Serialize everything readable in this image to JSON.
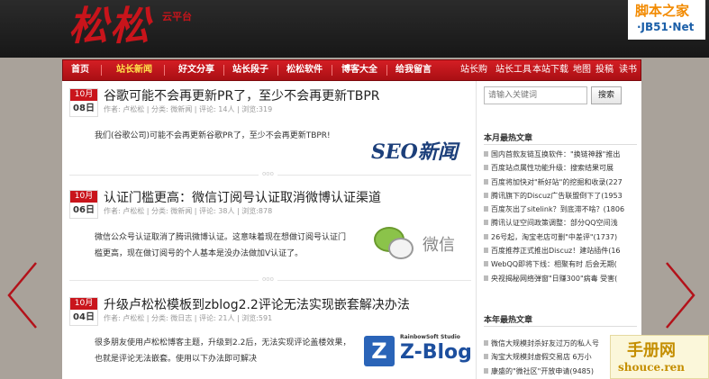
{
  "header": {
    "logo": "松松",
    "logo_sub": "云平台",
    "corner_logo_line1": "脚本之家",
    "corner_logo_line2": "·JB51·Net"
  },
  "nav": {
    "left": [
      "首页",
      "站长新闻",
      "好文分享",
      "站长段子",
      "松松软件",
      "博客大全",
      "给我留言"
    ],
    "active_index": 1,
    "right": [
      "站长购",
      "站长工具",
      "本站下载",
      "地图",
      "投稿",
      "读书"
    ]
  },
  "posts": [
    {
      "month": "10月",
      "day": "08日",
      "title": "谷歌可能不会再更新PR了，至少不会再更新TBPR",
      "meta": "作者: 卢松松 | 分类: 微新闻 | 评论: 14人 | 浏览:319",
      "excerpt_line1": "我们(谷歌公司)可能不会再更新谷歌PR了，至少不会再更新TBPR!",
      "excerpt_line2": "",
      "image_text": "SEO新闻"
    },
    {
      "month": "10月",
      "day": "06日",
      "title": "认证门槛更高：微信订阅号认证取消微博认证渠道",
      "meta": "作者: 卢松松 | 分类: 微新闻 | 评论: 38人 | 浏览:878",
      "excerpt_line1": "微信公众号认证取消了腾讯微博认证。这意味着现在想做订阅号认证门",
      "excerpt_line2": "槛更高，现在做订阅号的个人基本是没办法做加V认证了。",
      "image_text": "微信"
    },
    {
      "month": "10月",
      "day": "04日",
      "title": "升级卢松松模板到zblog2.2评论无法实现嵌套解决办法",
      "meta": "作者: 卢松松 | 分类: 微日志 | 评论: 21人 | 浏览:591",
      "excerpt_line1": "很多朋友使用卢松松博客主题，升级到2.2后，无法实现评论盖楼效果，",
      "excerpt_line2": "也就是评论无法嵌套。使用以下办法即可解决",
      "image_text_small": "RainbowSoft Studio",
      "image_text": "Z-Blog"
    }
  ],
  "divider_label": "ooo",
  "search": {
    "placeholder": "请输入关键词",
    "button": "搜索"
  },
  "sidebar": {
    "monthly_title": "本月最热文章",
    "monthly": [
      "国内首款友链互换软件：\"换链神器\"推出",
      "百度站点属性功能升级：搜索结果可展",
      "百度将加快对\"新好站\"的挖掘和收录(227",
      "腾讯旗下的Discuz广告联盟倒下了(1953",
      "百度灰出了sitelink？到底滞不啥？(1806",
      "腾讯认证空间政策调整：部分QQ空间浅",
      "26号起，淘宝老店可删\"中差评\"(1737)",
      "百度推荐正式推出Discuz！建站插件(16",
      "WebQQ即将下线：相聚有时 后会无期(",
      "央视揭秘网络弹窗\"日赚300\"病毒 受害("
    ],
    "yearly_title": "本年最热文章",
    "yearly": [
      "微信大规模封杀好友过万的私人号",
      "淘宝大规模封虚假交易店 6万小",
      "康盛的\"微社区\"开放申请(9485)"
    ]
  },
  "watermark": {
    "line1": "手册网",
    "line2": "shouce.ren"
  },
  "colors": {
    "brand_red": "#c8141b",
    "nav_red": "#c4161c",
    "page_bg": "#a9a29a",
    "date_red": "#c9151c"
  }
}
